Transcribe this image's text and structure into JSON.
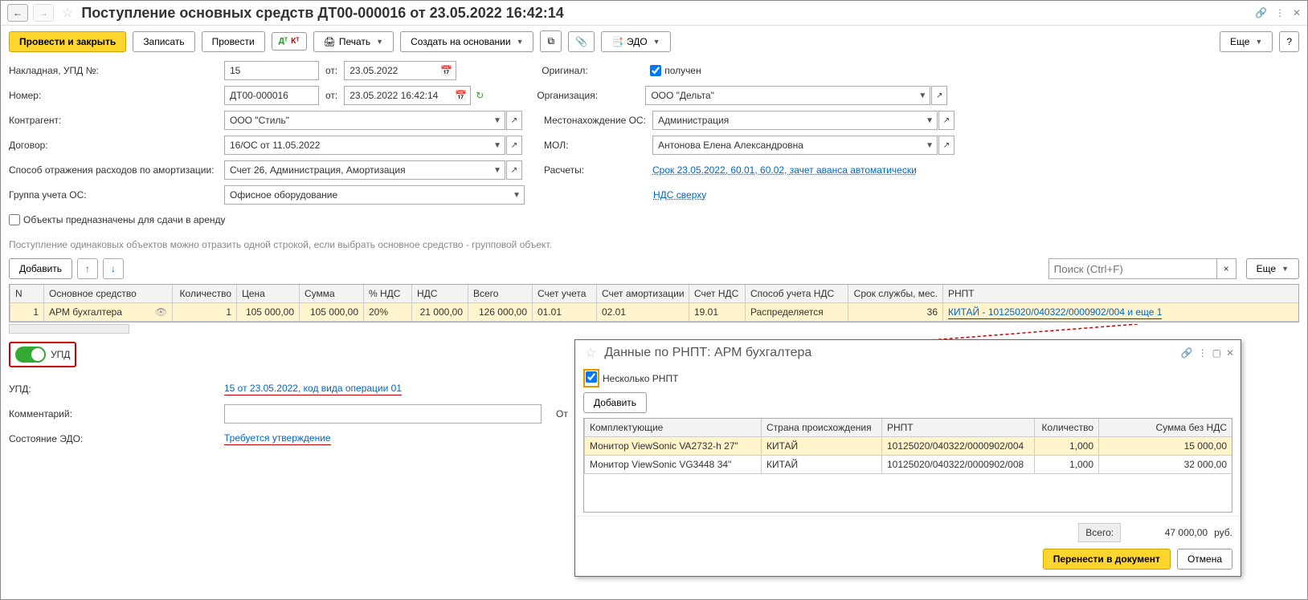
{
  "header": {
    "title": "Поступление основных средств ДТ00-000016 от 23.05.2022 16:42:14"
  },
  "toolbar": {
    "post_close": "Провести и закрыть",
    "record": "Записать",
    "post": "Провести",
    "print": "Печать",
    "create_based": "Создать на основании",
    "edo": "ЭДО",
    "more": "Еще",
    "help": "?"
  },
  "form": {
    "invoice_label": "Накладная, УПД №:",
    "invoice_no": "15",
    "from": "от:",
    "invoice_date": "23.05.2022",
    "number_label": "Номер:",
    "number": "ДТ00-000016",
    "number_date": "23.05.2022 16:42:14",
    "counterparty_label": "Контрагент:",
    "counterparty": "ООО \"Стиль\"",
    "contract_label": "Договор:",
    "contract": "16/ОС от 11.05.2022",
    "expense_method_label": "Способ отражения расходов по амортизации:",
    "expense_method": "Счет 26, Администрация, Амортизация",
    "group_label": "Группа учета ОС:",
    "group": "Офисное оборудование",
    "lease_chk": "Объекты предназначены для сдачи в аренду",
    "original_label": "Оригинал:",
    "original_chk": "получен",
    "org_label": "Организация:",
    "org": "ООО \"Дельта\"",
    "location_label": "Местонахождение ОС:",
    "location": "Администрация",
    "mol_label": "МОЛ:",
    "mol": "Антонова Елена Александровна",
    "calc_label": "Расчеты:",
    "calc_link": "Срок 23.05.2022, 60.01, 60.02, зачет аванса автоматически",
    "nds_link": "НДС сверху"
  },
  "hint": "Поступление одинаковых объектов можно отразить одной строкой, если выбрать основное средство - групповой объект.",
  "table_controls": {
    "add": "Добавить",
    "search_ph": "Поиск (Ctrl+F)",
    "more": "Еще"
  },
  "grid": {
    "cols": [
      "N",
      "Основное средство",
      "Количество",
      "Цена",
      "Сумма",
      "% НДС",
      "НДС",
      "Всего",
      "Счет учета",
      "Счет амортизации",
      "Счет НДС",
      "Способ учета НДС",
      "Срок службы, мес.",
      "РНПТ"
    ],
    "row": {
      "n": "1",
      "os": "АРМ бухгалтера",
      "qty": "1",
      "price": "105 000,00",
      "sum": "105 000,00",
      "nds_pct": "20%",
      "nds": "21 000,00",
      "total": "126 000,00",
      "acc": "01.01",
      "acc_am": "02.01",
      "acc_nds": "19.01",
      "nds_mode": "Распределяется",
      "life": "36",
      "rnpt": "КИТАЙ - 10125020/040322/0000902/004 и еще 1"
    }
  },
  "switch": {
    "label": "УПД"
  },
  "footer": {
    "upd_label": "УПД:",
    "upd_link": "15 от 23.05.2022, код вида операции 01",
    "comment_label": "Комментарий:",
    "resp_label": "От",
    "edo_state_label": "Состояние ЭДО:",
    "edo_state_link": "Требуется утверждение"
  },
  "popup": {
    "title": "Данные по РНПТ: АРМ бухгалтера",
    "multi_chk": "Несколько РНПТ",
    "add": "Добавить",
    "cols": [
      "Комплектующие",
      "Страна происхождения",
      "РНПТ",
      "Количество",
      "Сумма без НДС"
    ],
    "rows": [
      {
        "name": "Монитор ViewSonic VA2732-h 27\"",
        "country": "КИТАЙ",
        "rnpt": "10125020/040322/0000902/004",
        "qty": "1,000",
        "sum": "15 000,00"
      },
      {
        "name": "Монитор ViewSonic VG3448 34\"",
        "country": "КИТАЙ",
        "rnpt": "10125020/040322/0000902/008",
        "qty": "1,000",
        "sum": "32 000,00"
      }
    ],
    "total_label": "Всего:",
    "total": "47 000,00",
    "currency": "руб.",
    "submit": "Перенести в документ",
    "cancel": "Отмена"
  }
}
